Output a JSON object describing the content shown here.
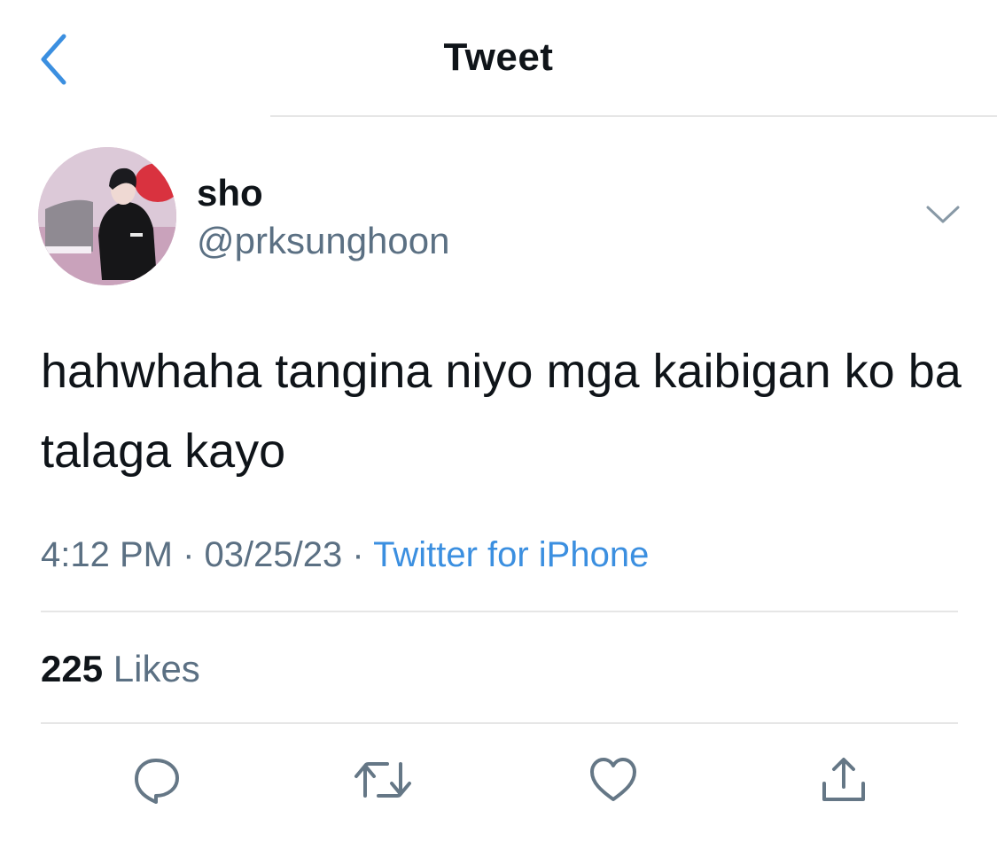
{
  "header": {
    "title": "Tweet"
  },
  "author": {
    "name": "sho",
    "handle": "@prksunghoon"
  },
  "tweet": {
    "text": "hahwhaha tangina niyo mga kaibigan ko ba talaga kayo",
    "time": "4:12 PM",
    "date": "03/25/23",
    "separator": "·",
    "source": "Twitter for iPhone"
  },
  "stats": {
    "likes_count": "225",
    "likes_label": "Likes"
  },
  "icons": {
    "back": "chevron-left-icon",
    "more": "chevron-down-icon",
    "reply": "reply-icon",
    "retweet": "retweet-icon",
    "like": "heart-icon",
    "share": "share-icon"
  },
  "colors": {
    "accent": "#3b8fe0",
    "secondary_text": "#5b7083",
    "icon_gray": "#657786"
  }
}
